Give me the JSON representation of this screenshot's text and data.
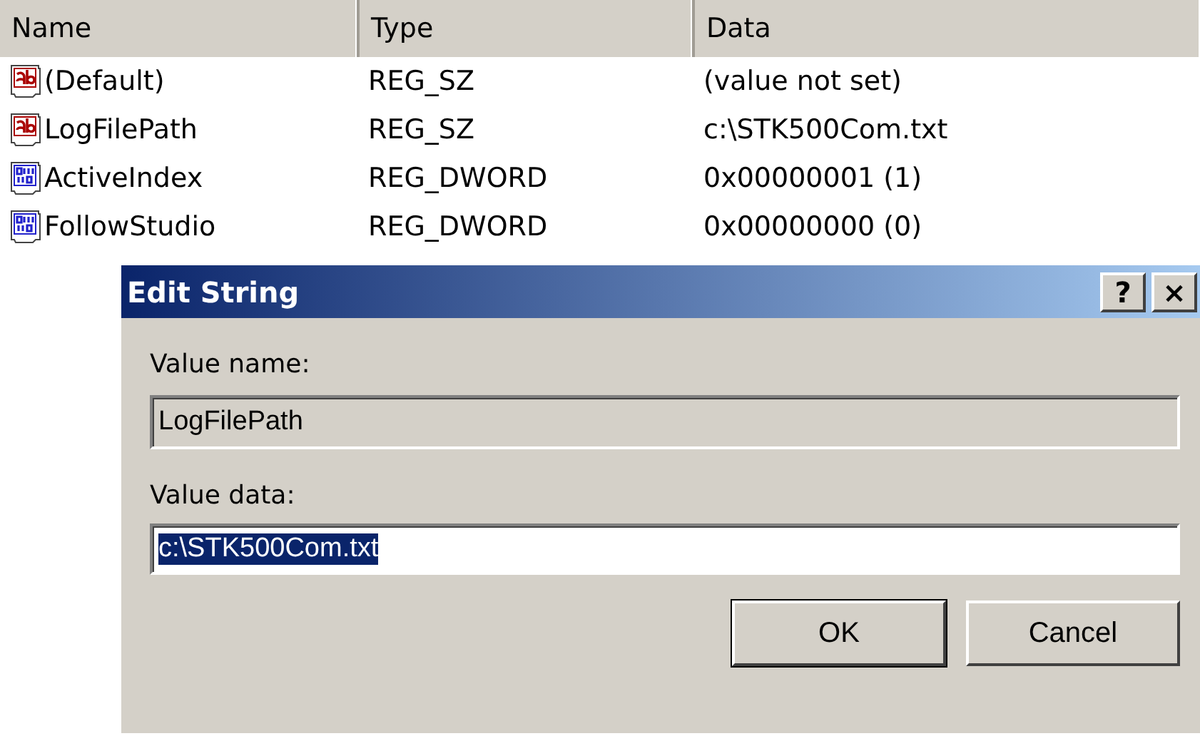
{
  "table": {
    "columns": [
      "Name",
      "Type",
      "Data"
    ],
    "rows": [
      {
        "kind": "string",
        "name": "(Default)",
        "type": "REG_SZ",
        "data": "(value not set)"
      },
      {
        "kind": "string",
        "name": "LogFilePath",
        "type": "REG_SZ",
        "data": "c:\\STK500Com.txt"
      },
      {
        "kind": "binary",
        "name": "ActiveIndex",
        "type": "REG_DWORD",
        "data": "0x00000001 (1)"
      },
      {
        "kind": "binary",
        "name": "FollowStudio",
        "type": "REG_DWORD",
        "data": "0x00000000 (0)"
      }
    ]
  },
  "dialog": {
    "title": "Edit String",
    "help_button": "?",
    "close_button": "×",
    "value_name_label": "Value name:",
    "value_name": "LogFilePath",
    "value_data_label": "Value data:",
    "value_data": "c:\\STK500Com.txt",
    "value_data_selected": true,
    "buttons": [
      "OK",
      "Cancel"
    ]
  }
}
